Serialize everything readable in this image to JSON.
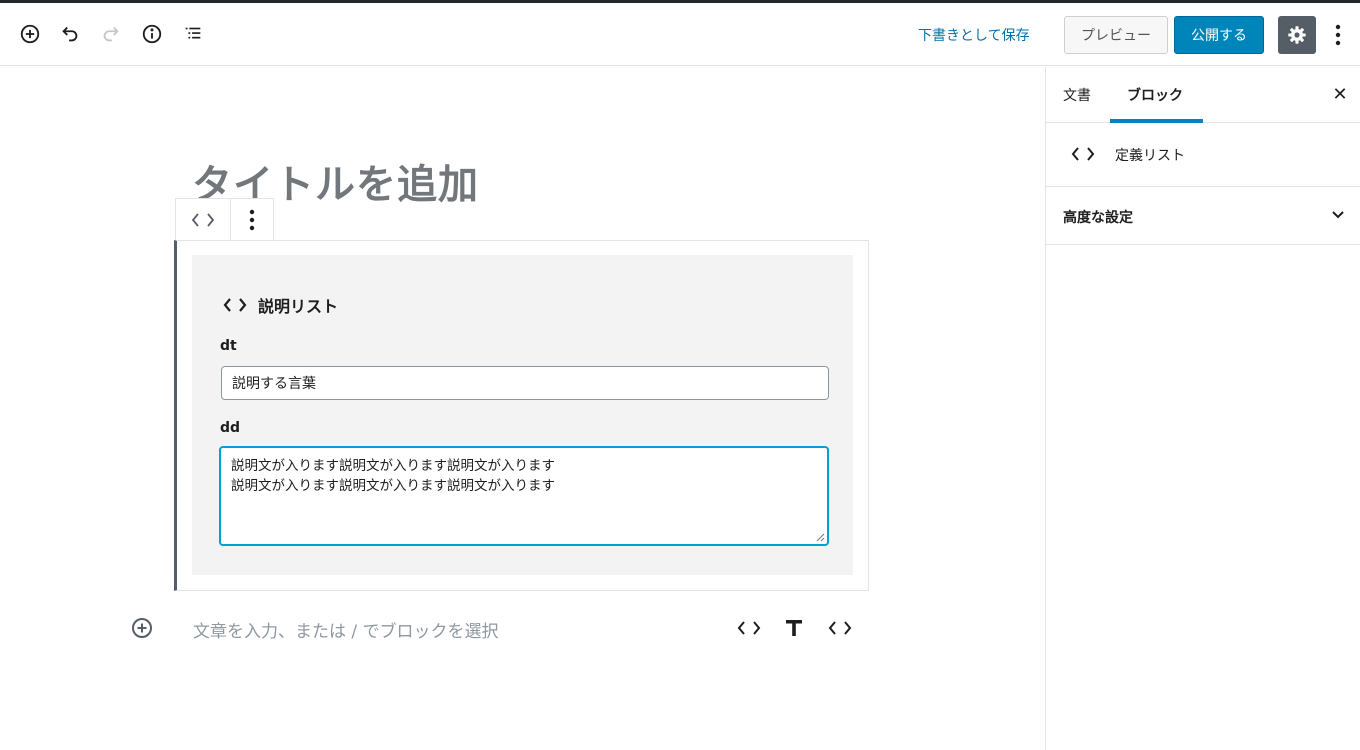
{
  "toolbar": {
    "add_block_icon": "plus-circle-icon",
    "undo_icon": "undo-icon",
    "redo_icon": "redo-icon",
    "info_icon": "info-icon",
    "outline_icon": "list-outline-icon",
    "save_draft_label": "下書きとして保存",
    "preview_label": "プレビュー",
    "publish_label": "公開する",
    "settings_icon": "gear-icon",
    "more_icon": "more-vertical-icon"
  },
  "sidebar": {
    "tabs": [
      {
        "label": "文書",
        "active": false
      },
      {
        "label": "ブロック",
        "active": true
      }
    ],
    "close_icon": "close-icon",
    "block_name": "定義リスト",
    "block_icon": "code-brackets-icon",
    "panels": [
      {
        "title": "高度な設定",
        "expanded": false
      }
    ]
  },
  "editor": {
    "title_placeholder": "タイトルを追加",
    "block": {
      "heading": "説明リスト",
      "dt_label": "dt",
      "dt_value": "説明する言葉",
      "dd_label": "dd",
      "dd_lines": [
        "説明文が入ります説明文が入ります説明文が入ります",
        "説明文が入ります説明文が入ります説明文が入ります"
      ]
    },
    "appender_placeholder": "文章を入力、または / でブロックを選択"
  },
  "colors": {
    "accent": "#0085ba",
    "link": "#0073aa",
    "focus": "#00a0d2",
    "settings_bg": "#555d66"
  }
}
